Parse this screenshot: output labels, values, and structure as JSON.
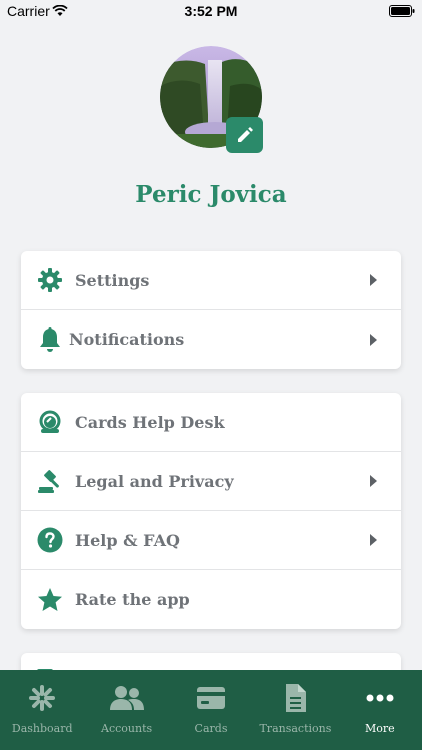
{
  "status_bar": {
    "carrier": "Carrier",
    "time": "3:52 PM"
  },
  "profile": {
    "name": "Peric Jovica"
  },
  "menu_group_1": [
    {
      "label": "Settings",
      "icon": "gear-icon"
    },
    {
      "label": "Notifications",
      "icon": "bell-icon"
    }
  ],
  "menu_group_2": [
    {
      "label": "Cards Help Desk",
      "icon": "headset-icon"
    },
    {
      "label": "Legal and Privacy",
      "icon": "gavel-icon"
    },
    {
      "label": "Help & FAQ",
      "icon": "question-icon"
    },
    {
      "label": "Rate the app",
      "icon": "star-icon"
    }
  ],
  "tabs": [
    {
      "label": "Dashboard",
      "icon": "dashboard-icon"
    },
    {
      "label": "Accounts",
      "icon": "accounts-icon"
    },
    {
      "label": "Cards",
      "icon": "card-icon"
    },
    {
      "label": "Transactions",
      "icon": "transactions-icon"
    },
    {
      "label": "More",
      "icon": "more-icon"
    }
  ],
  "colors": {
    "accent": "#2b8a6a",
    "tab_bar": "#1f5e45",
    "background": "#f1f2f4"
  }
}
